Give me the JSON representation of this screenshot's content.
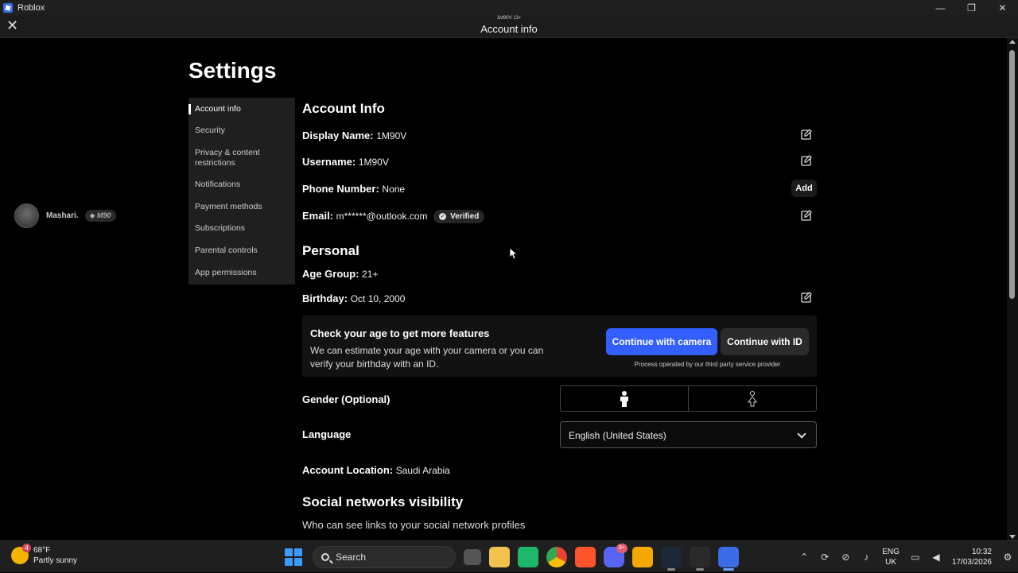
{
  "window": {
    "app_title": "Roblox",
    "minimize": "—",
    "maximize": "❐",
    "close": "✕"
  },
  "header": {
    "subtitle": "1M90V 13+",
    "title": "Account info",
    "close_glyph": "✕"
  },
  "profile": {
    "name": "Mashari.",
    "badge": "M90"
  },
  "settings": {
    "title": "Settings",
    "nav": [
      {
        "label": "Account info",
        "active": true
      },
      {
        "label": "Security"
      },
      {
        "label": "Privacy & content restrictions"
      },
      {
        "label": "Notifications"
      },
      {
        "label": "Payment methods"
      },
      {
        "label": "Subscriptions"
      },
      {
        "label": "Parental controls"
      },
      {
        "label": "App permissions"
      }
    ]
  },
  "account_info": {
    "heading": "Account Info",
    "display_name_label": "Display Name:",
    "display_name": "1M90V",
    "username_label": "Username:",
    "username": "1M90V",
    "phone_label": "Phone Number:",
    "phone": "None",
    "add_label": "Add",
    "email_label": "Email:",
    "email": "m******@outlook.com",
    "verified_label": "Verified"
  },
  "personal": {
    "heading": "Personal",
    "age_group_label": "Age Group:",
    "age_group": "21+",
    "birthday_label": "Birthday:",
    "birthday": "Oct 10, 2000",
    "age_check_title": "Check your age to get more features",
    "age_check_text": "We can estimate your age with your camera or you can verify your birthday with an ID.",
    "camera_button": "Continue with camera",
    "id_button": "Continue with ID",
    "provider_note": "Process operated by our third party service provider",
    "gender_label": "Gender (Optional)",
    "language_label": "Language",
    "language_value": "English (United States)",
    "location_label": "Account Location:",
    "location": "Saudi Arabia"
  },
  "social": {
    "heading": "Social networks visibility",
    "subtext": "Who can see links to your social network profiles"
  },
  "taskbar": {
    "temperature": "68°F",
    "weather": "Partly sunny",
    "weather_alert": "4",
    "search_label": "Search",
    "discord_badge": "9+",
    "lang_top": "ENG",
    "lang_bottom": "UK",
    "time": "10:32",
    "date": "17/03/2026"
  },
  "colors": {
    "accent_blue": "#335fff",
    "background": "#000000",
    "panel": "#1f1f1f"
  }
}
